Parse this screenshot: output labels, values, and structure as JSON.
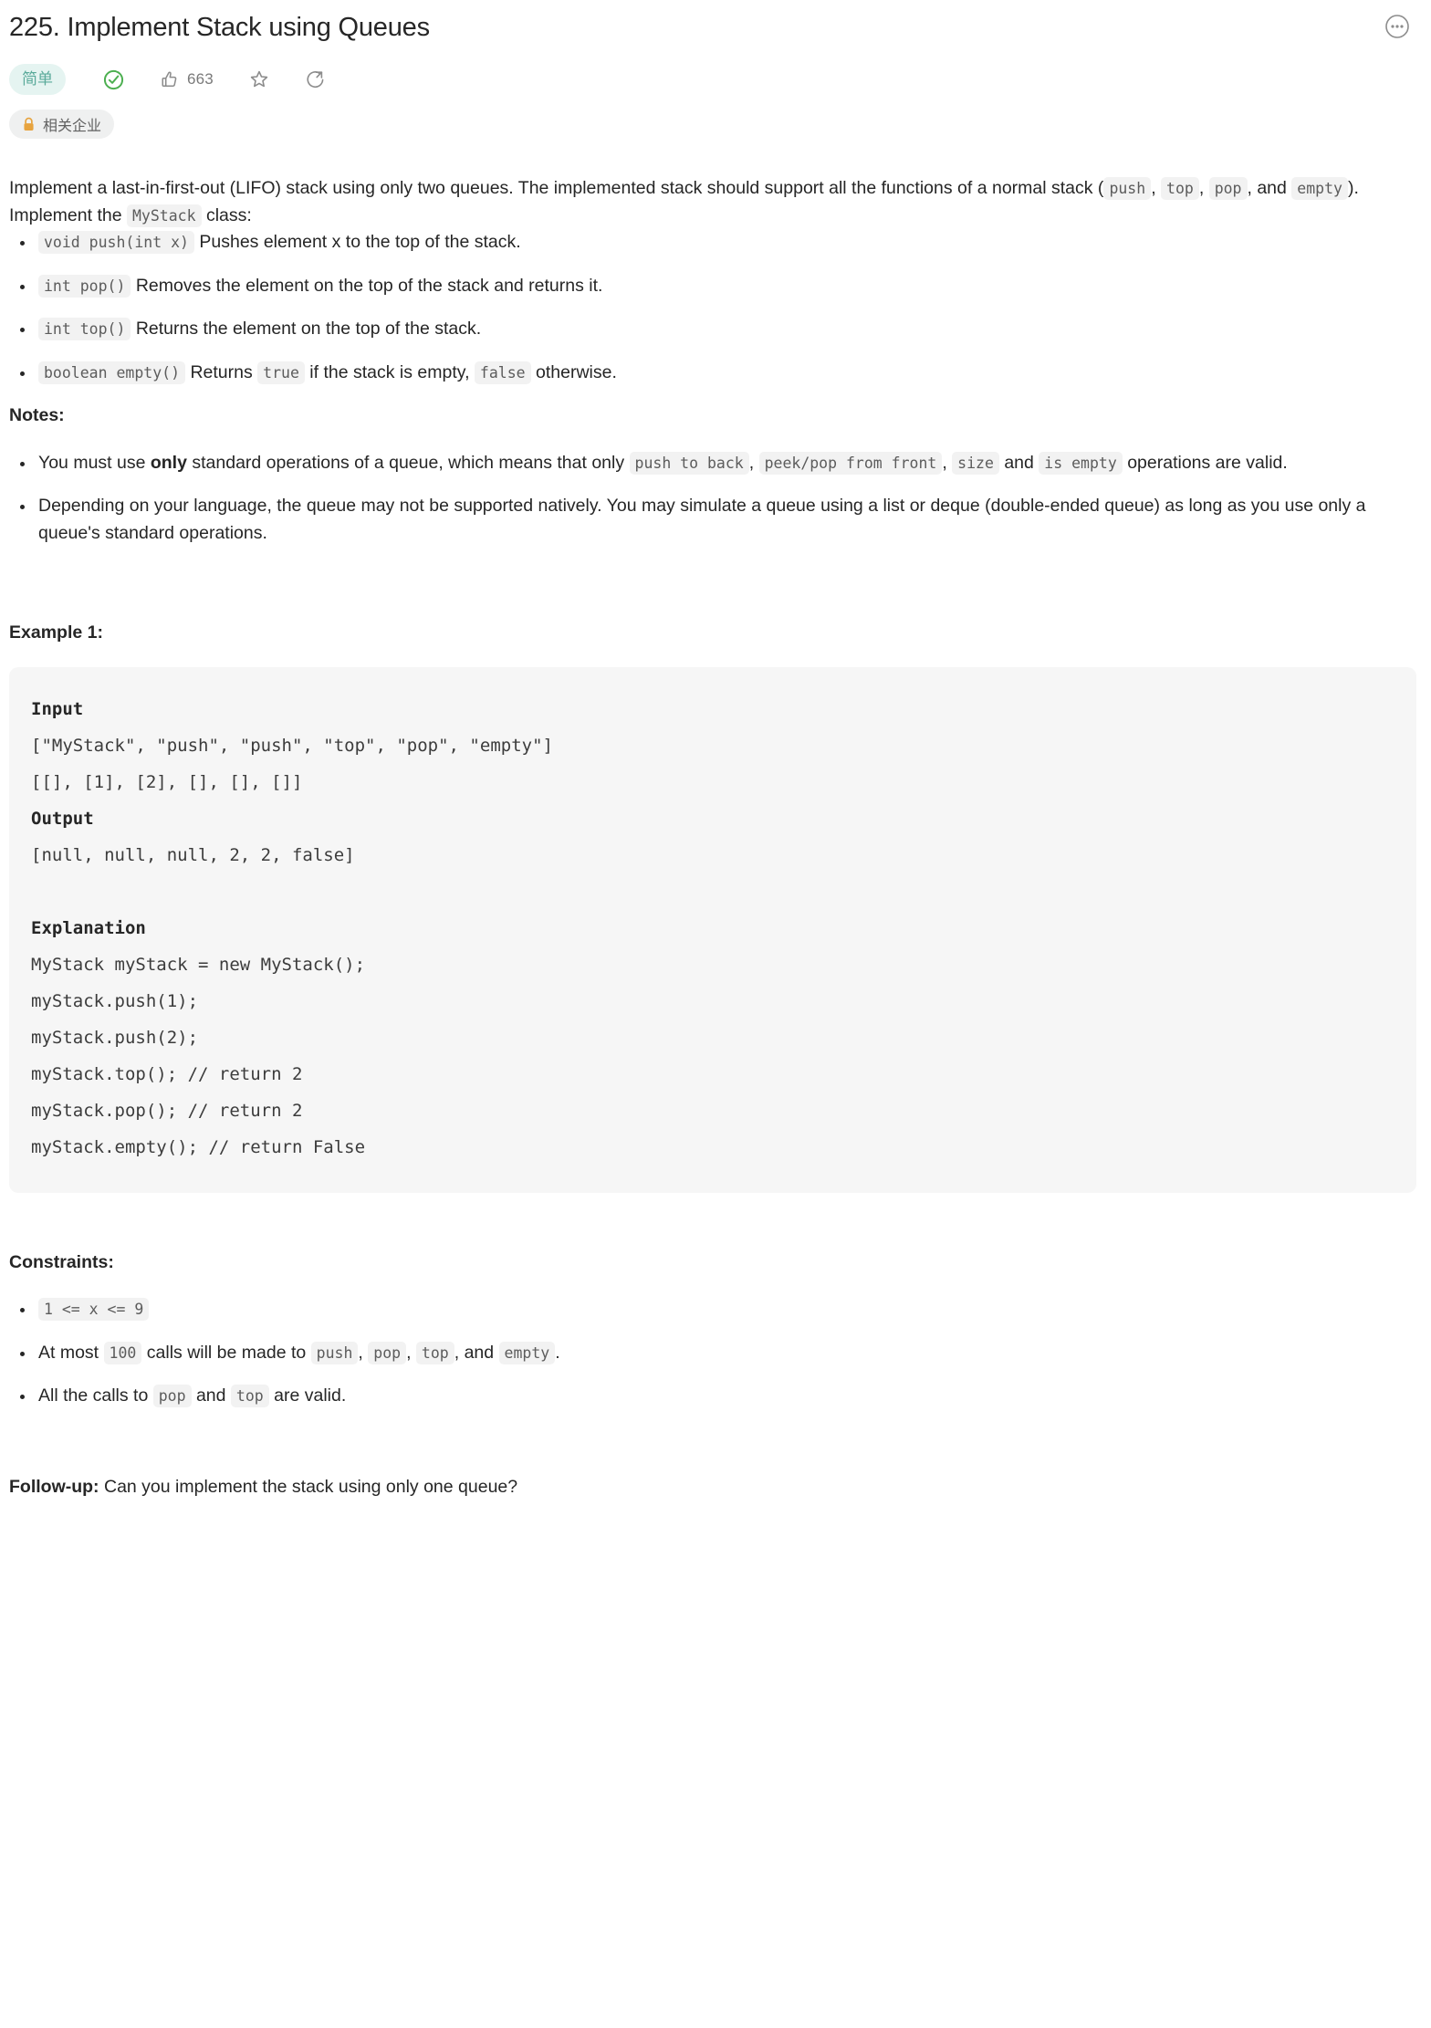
{
  "header": {
    "title": "225. Implement Stack using Queues",
    "more_icon": "more-horizontal-circle-icon",
    "difficulty": "简单",
    "solved_icon": "check-circle-icon",
    "like_icon": "thumbs-up-icon",
    "like_count": "663",
    "star_icon": "star-icon",
    "share_icon": "share-icon",
    "company_tag": {
      "lock_icon": "lock-icon",
      "label": "相关企业"
    }
  },
  "description": {
    "intro_1": "Implement a last-in-first-out (LIFO) stack using only two queues. The implemented stack should support all the functions of a normal stack (",
    "intro_code_push": "push",
    "intro_sep_1": ", ",
    "intro_code_top": "top",
    "intro_sep_2": ", ",
    "intro_code_pop": "pop",
    "intro_sep_3": ", and ",
    "intro_code_empty": "empty",
    "intro_end": ").",
    "class_line_pre": "Implement the ",
    "class_name": "MyStack",
    "class_line_post": " class:",
    "methods": [
      {
        "signature": "void push(int x)",
        "desc": "Pushes element x to the top of the stack."
      },
      {
        "signature": "int pop()",
        "desc": "Removes the element on the top of the stack and returns it."
      },
      {
        "signature": "int top()",
        "desc": "Returns the element on the top of the stack."
      }
    ],
    "empty_method": {
      "signature": "boolean empty()",
      "part1": "Returns ",
      "code_true": "true",
      "part2": " if the stack is empty, ",
      "code_false": "false",
      "part3": " otherwise."
    }
  },
  "notes": {
    "heading": "Notes:",
    "note1_part1": "You must use ",
    "note1_bold": "only",
    "note1_part2": " standard operations of a queue, which means that only ",
    "note1_code1": "push to back",
    "note1_sep1": ", ",
    "note1_code2": "peek/pop from front",
    "note1_sep2": ", ",
    "note1_code3": "size",
    "note1_sep3": " and ",
    "note1_code4": "is empty",
    "note1_part3": " operations are valid.",
    "note2": "Depending on your language, the queue may not be supported natively. You may simulate a queue using a list or deque (double-ended queue) as long as you use only a queue's standard operations."
  },
  "example": {
    "heading": "Example 1:",
    "input_label": "Input",
    "input_line1": "[\"MyStack\", \"push\", \"push\", \"top\", \"pop\", \"empty\"]",
    "input_line2": "[[], [1], [2], [], [], []]",
    "output_label": "Output",
    "output_line": "[null, null, null, 2, 2, false]",
    "explanation_label": "Explanation",
    "explanation_lines": "MyStack myStack = new MyStack();\nmyStack.push(1);\nmyStack.push(2);\nmyStack.top(); // return 2\nmyStack.pop(); // return 2\nmyStack.empty(); // return False"
  },
  "constraints": {
    "heading": "Constraints:",
    "c1_code": "1 <= x <= 9",
    "c2_part1": "At most ",
    "c2_code1": "100",
    "c2_part2": " calls will be made to ",
    "c2_code2": "push",
    "c2_sep1": ", ",
    "c2_code3": "pop",
    "c2_sep2": ", ",
    "c2_code4": "top",
    "c2_sep3": ", and ",
    "c2_code5": "empty",
    "c2_part3": ".",
    "c3_part1": "All the calls to ",
    "c3_code1": "pop",
    "c3_part2": " and ",
    "c3_code2": "top",
    "c3_part3": " are valid."
  },
  "followup": {
    "label": "Follow-up:",
    "text": " Can you implement the stack using only one queue?"
  },
  "colors": {
    "easy_text": "#5aaa9a",
    "easy_bg": "#e5f4f1",
    "check": "#4caf50",
    "lock": "#e7a33e",
    "code_bg": "#f2f2f2",
    "block_bg": "#f6f6f6"
  }
}
